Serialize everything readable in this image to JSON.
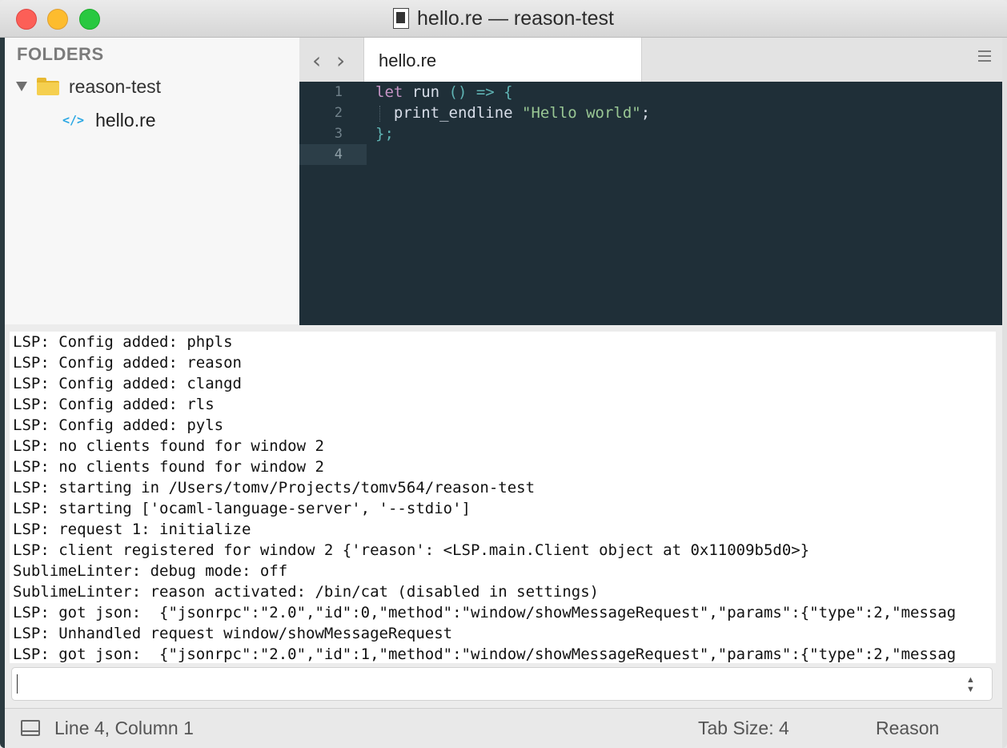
{
  "window": {
    "title": "hello.re — reason-test"
  },
  "sidebar": {
    "header": "FOLDERS",
    "folder": {
      "label": "reason-test",
      "expanded": true
    },
    "files": [
      {
        "label": "hello.re",
        "icon": "code-file-icon"
      }
    ]
  },
  "tabs": {
    "active_label": "hello.re"
  },
  "editor": {
    "line_numbers": [
      "1",
      "2",
      "3",
      "4"
    ],
    "active_line": 4,
    "code": {
      "l1_kw": "let",
      "l1_fn": " run ",
      "l1_op": "() => {",
      "l2_fn": "  print_endline ",
      "l2_str": "\"Hello world\"",
      "l2_end": ";",
      "l3_op": "};"
    },
    "colors": {
      "background": "#1f2f38",
      "keyword": "#c594c5",
      "operator": "#5fb3b3",
      "string": "#99c794"
    }
  },
  "console": {
    "lines": [
      "LSP: Config added: phpls",
      "LSP: Config added: reason",
      "LSP: Config added: clangd",
      "LSP: Config added: rls",
      "LSP: Config added: pyls",
      "LSP: no clients found for window 2",
      "LSP: no clients found for window 2",
      "LSP: starting in /Users/tomv/Projects/tomv564/reason-test",
      "LSP: starting ['ocaml-language-server', '--stdio']",
      "LSP: request 1: initialize",
      "LSP: client registered for window 2 {'reason': <LSP.main.Client object at 0x11009b5d0>}",
      "SublimeLinter: debug mode: off",
      "SublimeLinter: reason activated: /bin/cat (disabled in settings)",
      "LSP: got json:  {\"jsonrpc\":\"2.0\",\"id\":0,\"method\":\"window/showMessageRequest\",\"params\":{\"type\":2,\"messag",
      "LSP: Unhandled request window/showMessageRequest",
      "LSP: got json:  {\"jsonrpc\":\"2.0\",\"id\":1,\"method\":\"window/showMessageRequest\",\"params\":{\"type\":2,\"messag"
    ],
    "input_value": ""
  },
  "statusbar": {
    "position": "Line 4, Column 1",
    "tab_size": "Tab Size: 4",
    "syntax": "Reason"
  }
}
